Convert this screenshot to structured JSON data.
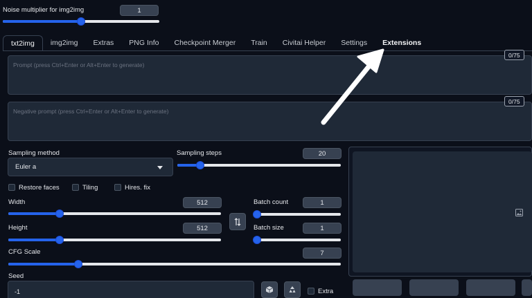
{
  "noise": {
    "label": "Noise multiplier for img2img",
    "value": "1",
    "fraction": 0.5
  },
  "tabs": [
    {
      "label": "txt2img"
    },
    {
      "label": "img2img"
    },
    {
      "label": "Extras"
    },
    {
      "label": "PNG Info"
    },
    {
      "label": "Checkpoint Merger"
    },
    {
      "label": "Train"
    },
    {
      "label": "Civitai Helper"
    },
    {
      "label": "Settings"
    },
    {
      "label": "Extensions"
    }
  ],
  "prompt": {
    "placeholder": "Prompt (press Ctrl+Enter or Alt+Enter to generate)",
    "counter": "0/75"
  },
  "negative_prompt": {
    "placeholder": "Negative prompt (press Ctrl+Enter or Alt+Enter to generate)",
    "counter": "0/75"
  },
  "sampling_method": {
    "label": "Sampling method",
    "value": "Euler a"
  },
  "sampling_steps": {
    "label": "Sampling steps",
    "value": "20",
    "fraction": 0.14
  },
  "checkboxes": {
    "restore_faces": "Restore faces",
    "tiling": "Tiling",
    "hires_fix": "Hires. fix"
  },
  "width": {
    "label": "Width",
    "value": "512",
    "fraction": 0.24
  },
  "height": {
    "label": "Height",
    "value": "512",
    "fraction": 0.24
  },
  "batch_count": {
    "label": "Batch count",
    "value": "1",
    "fraction": 0.0
  },
  "batch_size": {
    "label": "Batch size",
    "value": "1",
    "fraction": 0.0
  },
  "cfg_scale": {
    "label": "CFG Scale",
    "value": "7",
    "fraction": 0.21
  },
  "seed": {
    "label": "Seed",
    "value": "-1",
    "extra_label": "Extra"
  },
  "icons": {
    "swap": "swap-dimensions-icon",
    "image_placeholder": "image-icon",
    "dice": "dice-icon",
    "recycle": "recycle-icon",
    "dropdown": "chevron-down-icon",
    "annotation": "arrow-annotation-icon"
  },
  "colors": {
    "background": "#0b0f19",
    "panel": "#1f2937",
    "accent": "#2563eb",
    "box": "#374151"
  }
}
